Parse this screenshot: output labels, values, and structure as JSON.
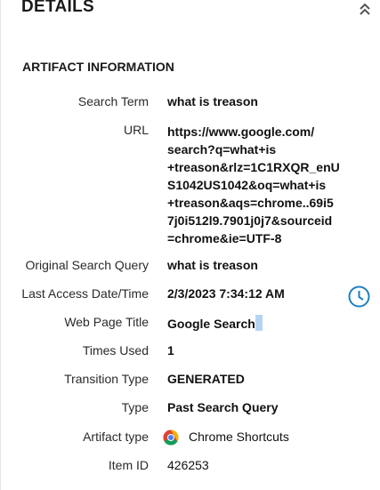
{
  "header": {
    "title": "DETAILS",
    "collapse_icon": "double-chevron-up-icon"
  },
  "section": {
    "title": "ARTIFACT INFORMATION"
  },
  "fields": {
    "search_term": {
      "label": "Search Term",
      "value": "what is treason"
    },
    "url": {
      "label": "URL",
      "value_lines": [
        "https://www.google.com/",
        "search?q=what+is",
        "+treason&rlz=1C1RXQR_enU",
        "S1042US1042&oq=what+is",
        "+treason&aqs=chrome..69i5",
        "7j0i512l9.7901j0j7&sourceid",
        "=chrome&ie=UTF-8"
      ]
    },
    "original_search_query": {
      "label": "Original Search Query",
      "value": "what is treason"
    },
    "last_access": {
      "label": "Last Access Date/Time",
      "value": "2/3/2023 7:34:12 AM",
      "icon": "clock-icon"
    },
    "web_page_title": {
      "label": "Web Page Title",
      "value": "Google Search"
    },
    "times_used": {
      "label": "Times Used",
      "value": "1"
    },
    "transition_type": {
      "label": "Transition Type",
      "value": "GENERATED"
    },
    "type": {
      "label": "Type",
      "value": "Past Search Query"
    },
    "artifact_type": {
      "label": "Artifact type",
      "value": "Chrome Shortcuts",
      "icon": "chrome-icon"
    },
    "item_id": {
      "label": "Item ID",
      "value": "426253"
    }
  },
  "colors": {
    "accent": "#1f7fc0",
    "selection": "#b5d4f4"
  }
}
